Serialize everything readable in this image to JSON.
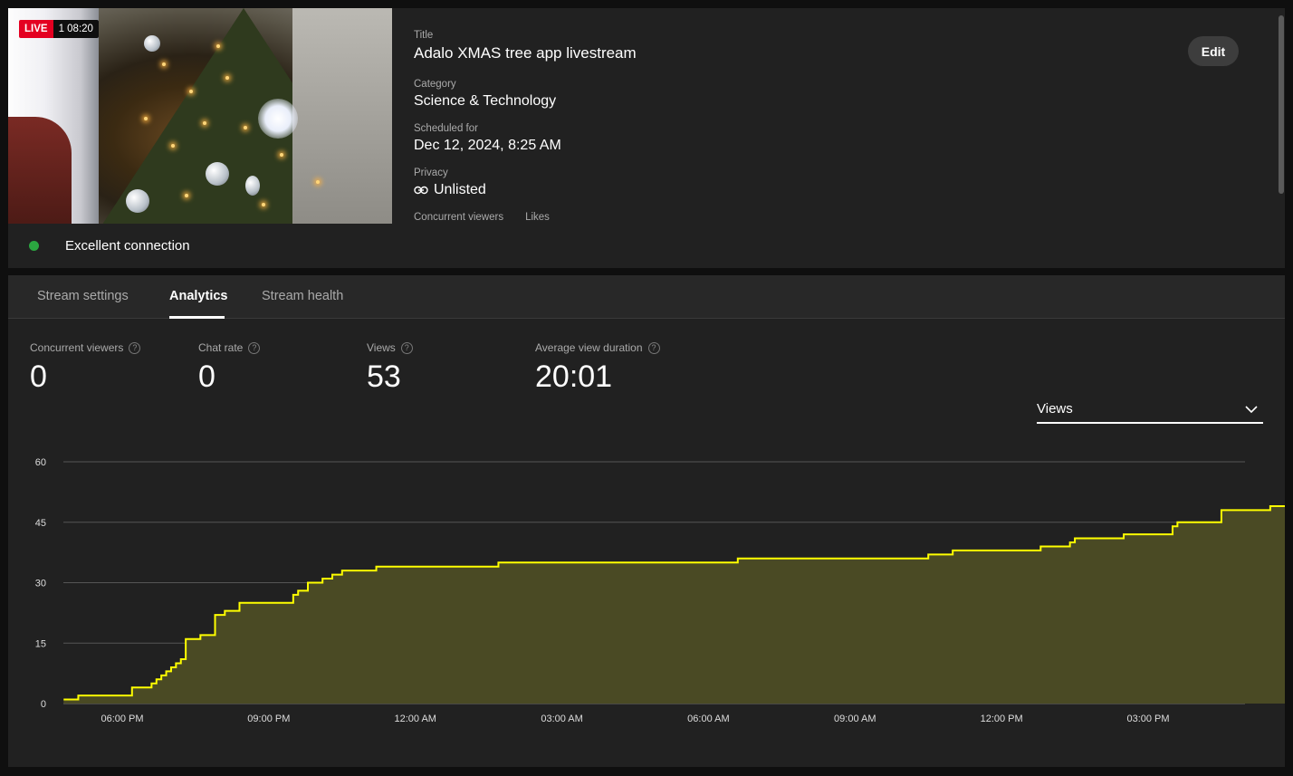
{
  "preview": {
    "live_label": "LIVE",
    "elapsed": "1 08:20"
  },
  "connection": {
    "status": "Excellent connection",
    "color": "#2ba640"
  },
  "details": {
    "title_label": "Title",
    "title_value": "Adalo XMAS tree app livestream",
    "category_label": "Category",
    "category_value": "Science & Technology",
    "scheduled_label": "Scheduled for",
    "scheduled_value": "Dec 12, 2024, 8:25 AM",
    "privacy_label": "Privacy",
    "privacy_icon": "link-icon",
    "privacy_value": "Unlisted",
    "concurrent_label": "Concurrent viewers",
    "likes_label": "Likes",
    "edit_label": "Edit"
  },
  "tabs": [
    {
      "label": "Stream settings",
      "active": false
    },
    {
      "label": "Analytics",
      "active": true
    },
    {
      "label": "Stream health",
      "active": false
    }
  ],
  "metrics": [
    {
      "label": "Concurrent viewers",
      "value": "0"
    },
    {
      "label": "Chat rate",
      "value": "0"
    },
    {
      "label": "Views",
      "value": "53"
    },
    {
      "label": "Average view duration",
      "value": "20:01"
    }
  ],
  "metric_select": {
    "selected": "Views",
    "icon": "chevron-down-icon"
  },
  "colors": {
    "line": "#ffff00",
    "fill": "#4a4a24",
    "grid": "#555555"
  },
  "chart_data": {
    "type": "area",
    "title": "",
    "xlabel": "",
    "ylabel": "",
    "ylim": [
      0,
      60
    ],
    "yticks": [
      0,
      15,
      30,
      45,
      60
    ],
    "xticks": [
      "06:00 PM",
      "09:00 PM",
      "12:00 AM",
      "03:00 AM",
      "06:00 AM",
      "09:00 AM",
      "12:00 PM",
      "03:00 PM"
    ],
    "x_hours_note_units": "hours",
    "x": [
      16.8,
      17.1,
      17.8,
      18.2,
      18.4,
      18.6,
      18.7,
      18.8,
      18.9,
      19.0,
      19.1,
      19.2,
      19.3,
      19.5,
      19.6,
      19.8,
      19.9,
      20.1,
      20.4,
      21.0,
      21.5,
      21.6,
      21.8,
      22.1,
      22.3,
      22.5,
      23.2,
      24.5,
      25.7,
      30.0,
      30.6,
      31.0,
      34.5,
      35.0,
      35.3,
      35.5,
      36.0,
      36.8,
      37.2,
      37.4,
      37.5,
      38.5,
      39.1,
      39.5,
      39.6,
      40.1,
      40.5,
      41.3,
      41.5,
      42.5,
      43.0,
      43.5,
      44.6,
      44.75
    ],
    "y": [
      1,
      2,
      2,
      4,
      4,
      5,
      6,
      7,
      8,
      9,
      10,
      11,
      16,
      16,
      17,
      17,
      22,
      23,
      25,
      25,
      27,
      28,
      30,
      31,
      32,
      33,
      34,
      34,
      35,
      35,
      36,
      36,
      37,
      38,
      38,
      38,
      38,
      39,
      39,
      40,
      41,
      42,
      42,
      44,
      45,
      45,
      48,
      48,
      49,
      50,
      51,
      52,
      53,
      53
    ]
  }
}
